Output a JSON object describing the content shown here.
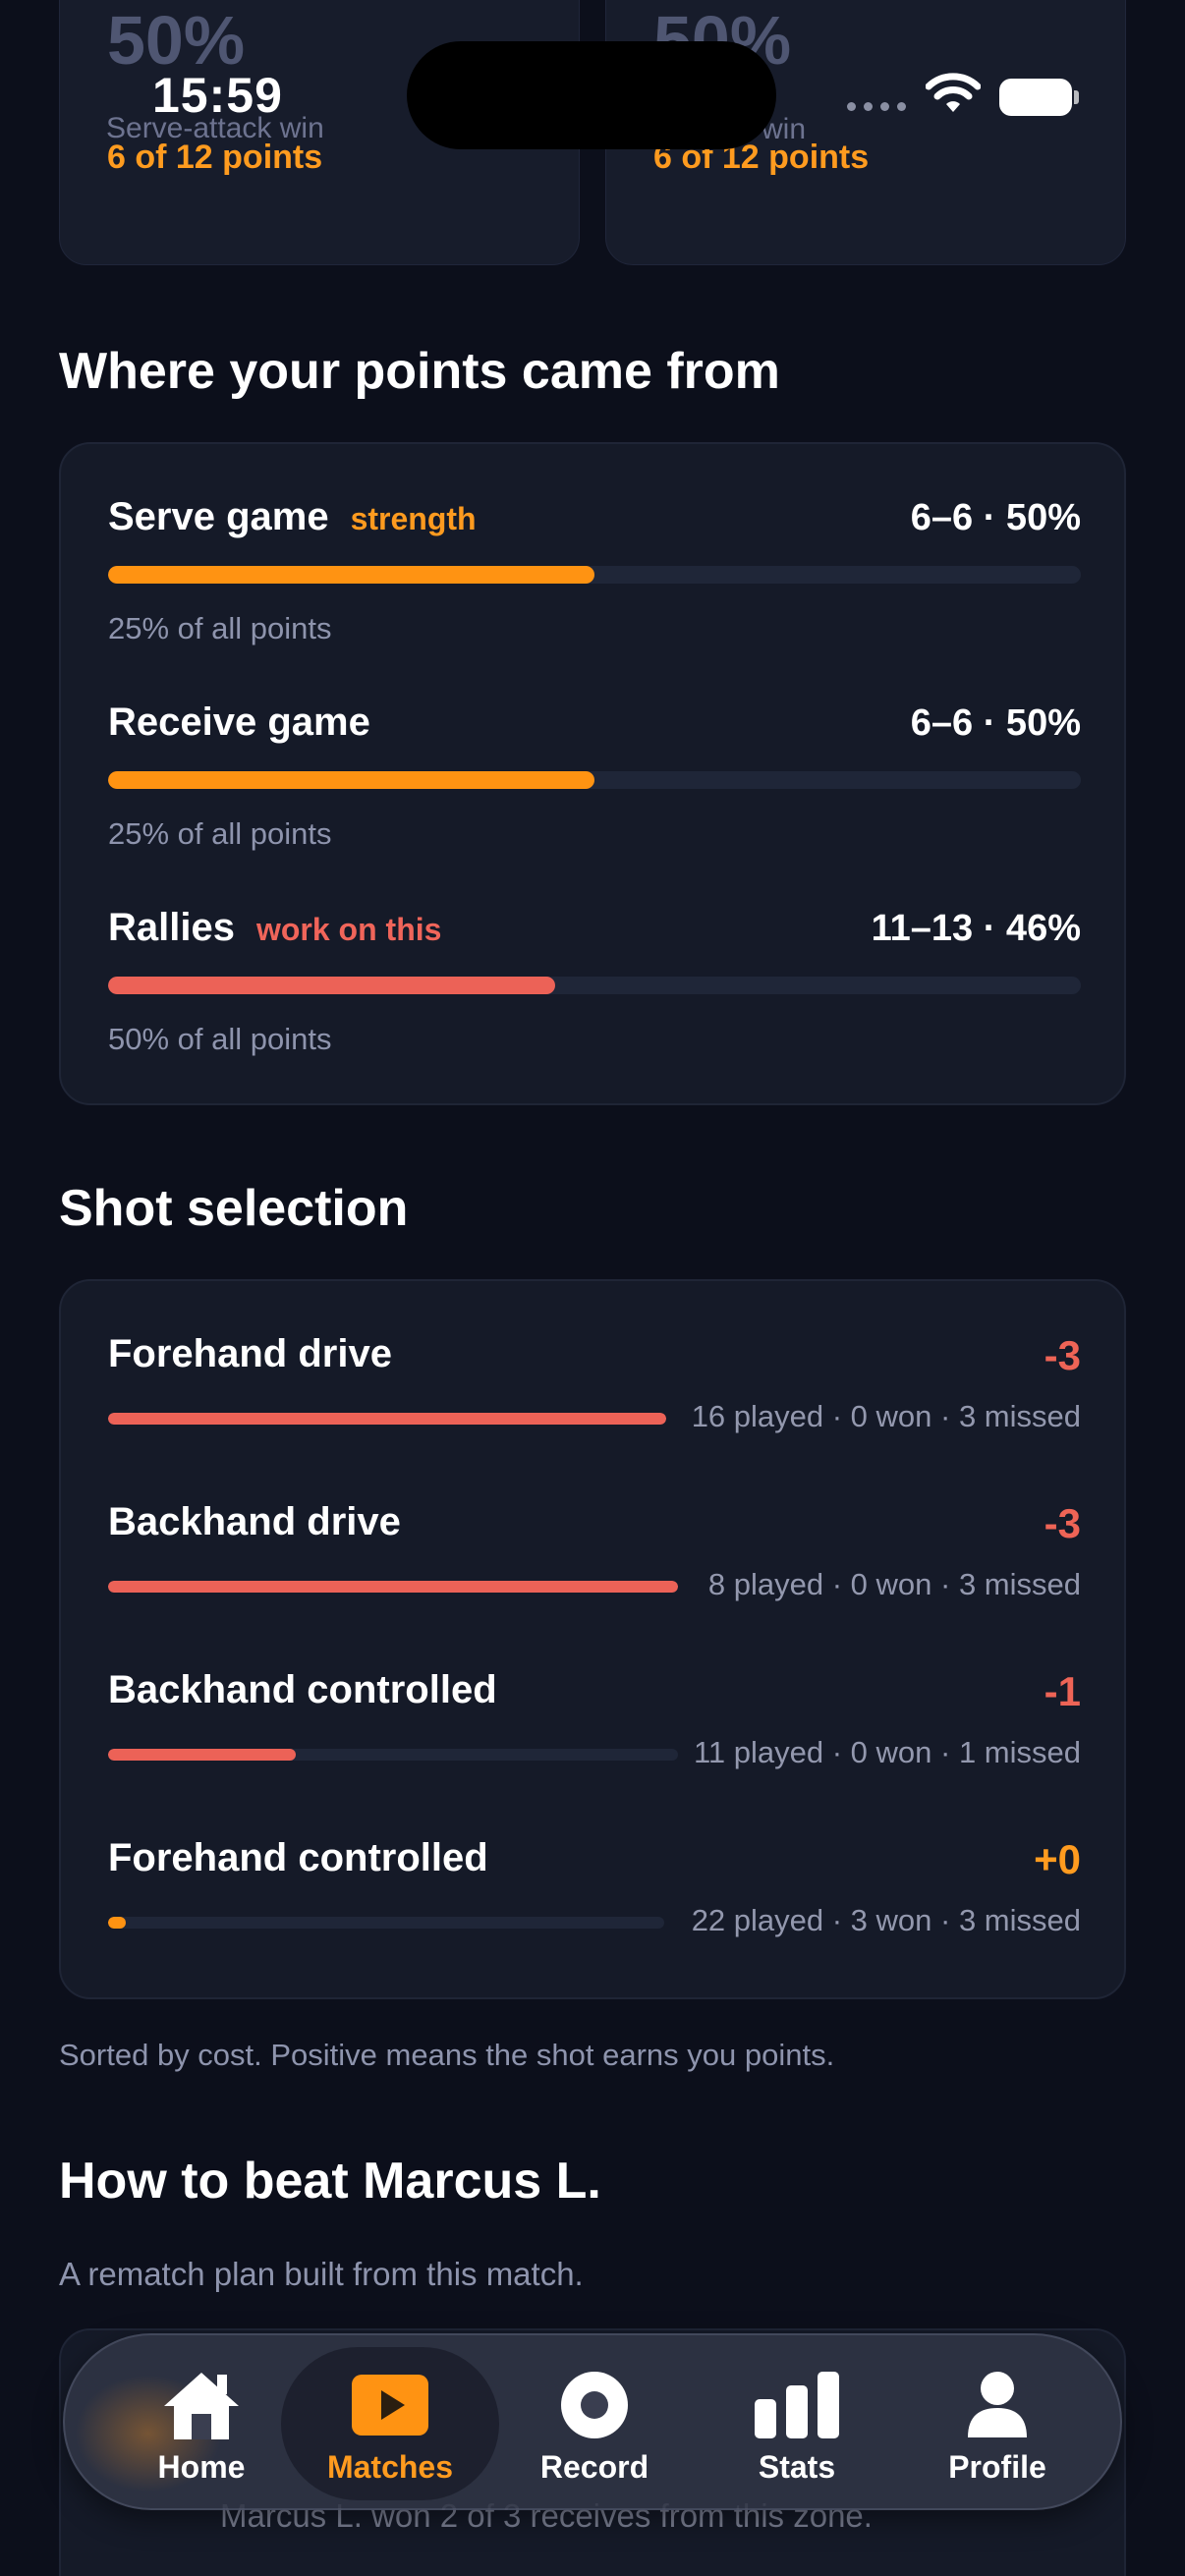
{
  "status_bar": {
    "time": "15:59"
  },
  "top_cards": [
    {
      "value": "50%",
      "label": "Serve-attack win",
      "points": "6 of 12 points"
    },
    {
      "value": "50%",
      "label": "win",
      "points": "6 of 12 points"
    }
  ],
  "points_section": {
    "title": "Where your points came from",
    "rows": [
      {
        "label": "Serve game",
        "tag": "strength",
        "score": "6–6 · 50%",
        "share": "25% of all points",
        "fill": 0.5
      },
      {
        "label": "Receive game",
        "tag": "",
        "score": "6–6 · 50%",
        "share": "25% of all points",
        "fill": 0.5
      },
      {
        "label": "Rallies",
        "tag": "work on this",
        "score": "11–13 · 46%",
        "share": "50% of all points",
        "fill": 0.46
      }
    ]
  },
  "shot_section": {
    "title": "Shot selection",
    "rows": [
      {
        "label": "Forehand drive",
        "net": "-3",
        "meta": "16 played · 0 won · 3 missed",
        "fill": 1.0
      },
      {
        "label": "Backhand drive",
        "net": "-3",
        "meta": "8 played · 0 won · 3 missed",
        "fill": 1.0
      },
      {
        "label": "Backhand controlled",
        "net": "-1",
        "meta": "11 played · 0 won · 1 missed",
        "fill": 0.33
      },
      {
        "label": "Forehand controlled",
        "net": "+0",
        "meta": "22 played · 3 won · 3 missed",
        "fill": 0.03
      }
    ],
    "note": "Sorted by cost. Positive means the shot earns you points."
  },
  "plan_section": {
    "title": "How to beat Marcus L.",
    "subtitle": "A rematch plan built from this match.",
    "peek_line": "Marcus L. won 2 of 3 receives from this zone."
  },
  "tabbar": {
    "items": [
      {
        "label": "Home",
        "icon": "home-icon"
      },
      {
        "label": "Matches",
        "icon": "play-icon"
      },
      {
        "label": "Record",
        "icon": "record-icon"
      },
      {
        "label": "Stats",
        "icon": "stats-icon"
      },
      {
        "label": "Profile",
        "icon": "profile-icon"
      }
    ],
    "active": "Matches"
  },
  "colors": {
    "accent": "#ff9b1f",
    "negative": "#ec6257",
    "background": "#0c0f1b",
    "card": "#151a28"
  }
}
